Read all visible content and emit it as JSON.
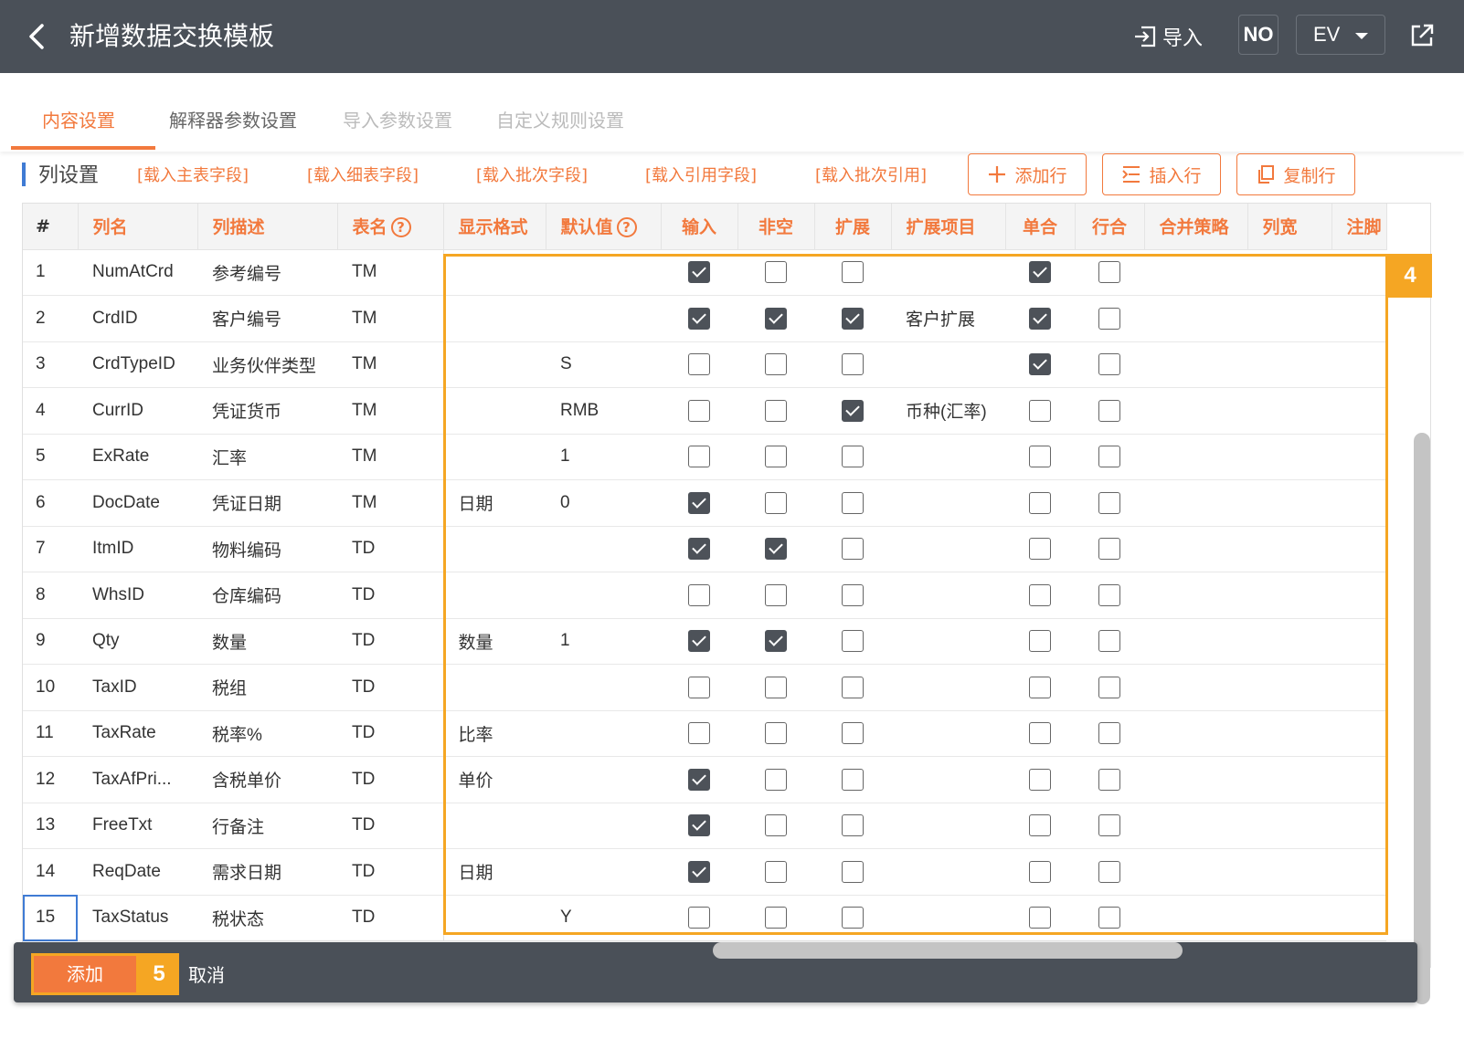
{
  "header": {
    "title": "新增数据交换模板",
    "import_label": "导入",
    "no_label": "NO",
    "ev_value": "EV"
  },
  "tabs": [
    {
      "label": "内容设置",
      "state": "active"
    },
    {
      "label": "解释器参数设置",
      "state": "normal"
    },
    {
      "label": "导入参数设置",
      "state": "disabled"
    },
    {
      "label": "自定义规则设置",
      "state": "disabled"
    }
  ],
  "section": {
    "title": "列设置",
    "links": [
      "[载入主表字段]",
      "[载入细表字段]",
      "[载入批次字段]",
      "[载入引用字段]",
      "[载入批次引用]"
    ],
    "buttons": {
      "add_row": "添加行",
      "insert_row": "插入行",
      "copy_row": "复制行"
    }
  },
  "table": {
    "headers": {
      "index": "#",
      "name": "列名",
      "desc": "列描述",
      "table": "表名",
      "format": "显示格式",
      "default": "默认值",
      "input": "输入",
      "notnull": "非空",
      "extend": "扩展",
      "extend_item": "扩展项目",
      "single": "单合",
      "row": "行合",
      "merge": "合并策略",
      "width": "列宽",
      "footer": "注脚"
    },
    "help_glyph": "?",
    "rows": [
      {
        "no": "1",
        "name": "NumAtCrd",
        "desc": "参考编号",
        "table": "TM",
        "format": "",
        "default": "",
        "input": true,
        "notnull": false,
        "extend": false,
        "extend_item": "",
        "single": true,
        "row": false
      },
      {
        "no": "2",
        "name": "CrdID",
        "desc": "客户编号",
        "table": "TM",
        "format": "",
        "default": "",
        "input": true,
        "notnull": true,
        "extend": true,
        "extend_item": "客户扩展",
        "single": true,
        "row": false
      },
      {
        "no": "3",
        "name": "CrdTypeID",
        "desc": "业务伙伴类型",
        "table": "TM",
        "format": "",
        "default": "S",
        "input": false,
        "notnull": false,
        "extend": false,
        "extend_item": "",
        "single": true,
        "row": false
      },
      {
        "no": "4",
        "name": "CurrID",
        "desc": "凭证货币",
        "table": "TM",
        "format": "",
        "default": "RMB",
        "input": false,
        "notnull": false,
        "extend": true,
        "extend_item": "币种(汇率)",
        "single": false,
        "row": false
      },
      {
        "no": "5",
        "name": "ExRate",
        "desc": "汇率",
        "table": "TM",
        "format": "",
        "default": "1",
        "input": false,
        "notnull": false,
        "extend": false,
        "extend_item": "",
        "single": false,
        "row": false
      },
      {
        "no": "6",
        "name": "DocDate",
        "desc": "凭证日期",
        "table": "TM",
        "format": "日期",
        "default": "0",
        "input": true,
        "notnull": false,
        "extend": false,
        "extend_item": "",
        "single": false,
        "row": false
      },
      {
        "no": "7",
        "name": "ItmID",
        "desc": "物料编码",
        "table": "TD",
        "format": "",
        "default": "",
        "input": true,
        "notnull": true,
        "extend": false,
        "extend_item": "",
        "single": false,
        "row": false
      },
      {
        "no": "8",
        "name": "WhsID",
        "desc": "仓库编码",
        "table": "TD",
        "format": "",
        "default": "",
        "input": false,
        "notnull": false,
        "extend": false,
        "extend_item": "",
        "single": false,
        "row": false
      },
      {
        "no": "9",
        "name": "Qty",
        "desc": "数量",
        "table": "TD",
        "format": "数量",
        "default": "1",
        "input": true,
        "notnull": true,
        "extend": false,
        "extend_item": "",
        "single": false,
        "row": false
      },
      {
        "no": "10",
        "name": "TaxID",
        "desc": "税组",
        "table": "TD",
        "format": "",
        "default": "",
        "input": false,
        "notnull": false,
        "extend": false,
        "extend_item": "",
        "single": false,
        "row": false
      },
      {
        "no": "11",
        "name": "TaxRate",
        "desc": "税率%",
        "table": "TD",
        "format": "比率",
        "default": "",
        "input": false,
        "notnull": false,
        "extend": false,
        "extend_item": "",
        "single": false,
        "row": false
      },
      {
        "no": "12",
        "name": "TaxAfPri...",
        "desc": "含税单价",
        "table": "TD",
        "format": "单价",
        "default": "",
        "input": true,
        "notnull": false,
        "extend": false,
        "extend_item": "",
        "single": false,
        "row": false
      },
      {
        "no": "13",
        "name": "FreeTxt",
        "desc": "行备注",
        "table": "TD",
        "format": "",
        "default": "",
        "input": true,
        "notnull": false,
        "extend": false,
        "extend_item": "",
        "single": false,
        "row": false
      },
      {
        "no": "14",
        "name": "ReqDate",
        "desc": "需求日期",
        "table": "TD",
        "format": "日期",
        "default": "",
        "input": true,
        "notnull": false,
        "extend": false,
        "extend_item": "",
        "single": false,
        "row": false
      },
      {
        "no": "15",
        "name": "TaxStatus",
        "desc": "税状态",
        "table": "TD",
        "format": "",
        "default": "Y",
        "input": false,
        "notnull": false,
        "extend": false,
        "extend_item": "",
        "single": false,
        "row": false
      }
    ]
  },
  "annotations": {
    "badge_4": "4",
    "badge_5": "5"
  },
  "footer": {
    "add_label": "添加",
    "cancel_label": "取消"
  },
  "colors": {
    "accent": "#f2793d",
    "highlight": "#f5a623",
    "header_bg": "#4a5058",
    "section_bar": "#3f7bd4"
  }
}
